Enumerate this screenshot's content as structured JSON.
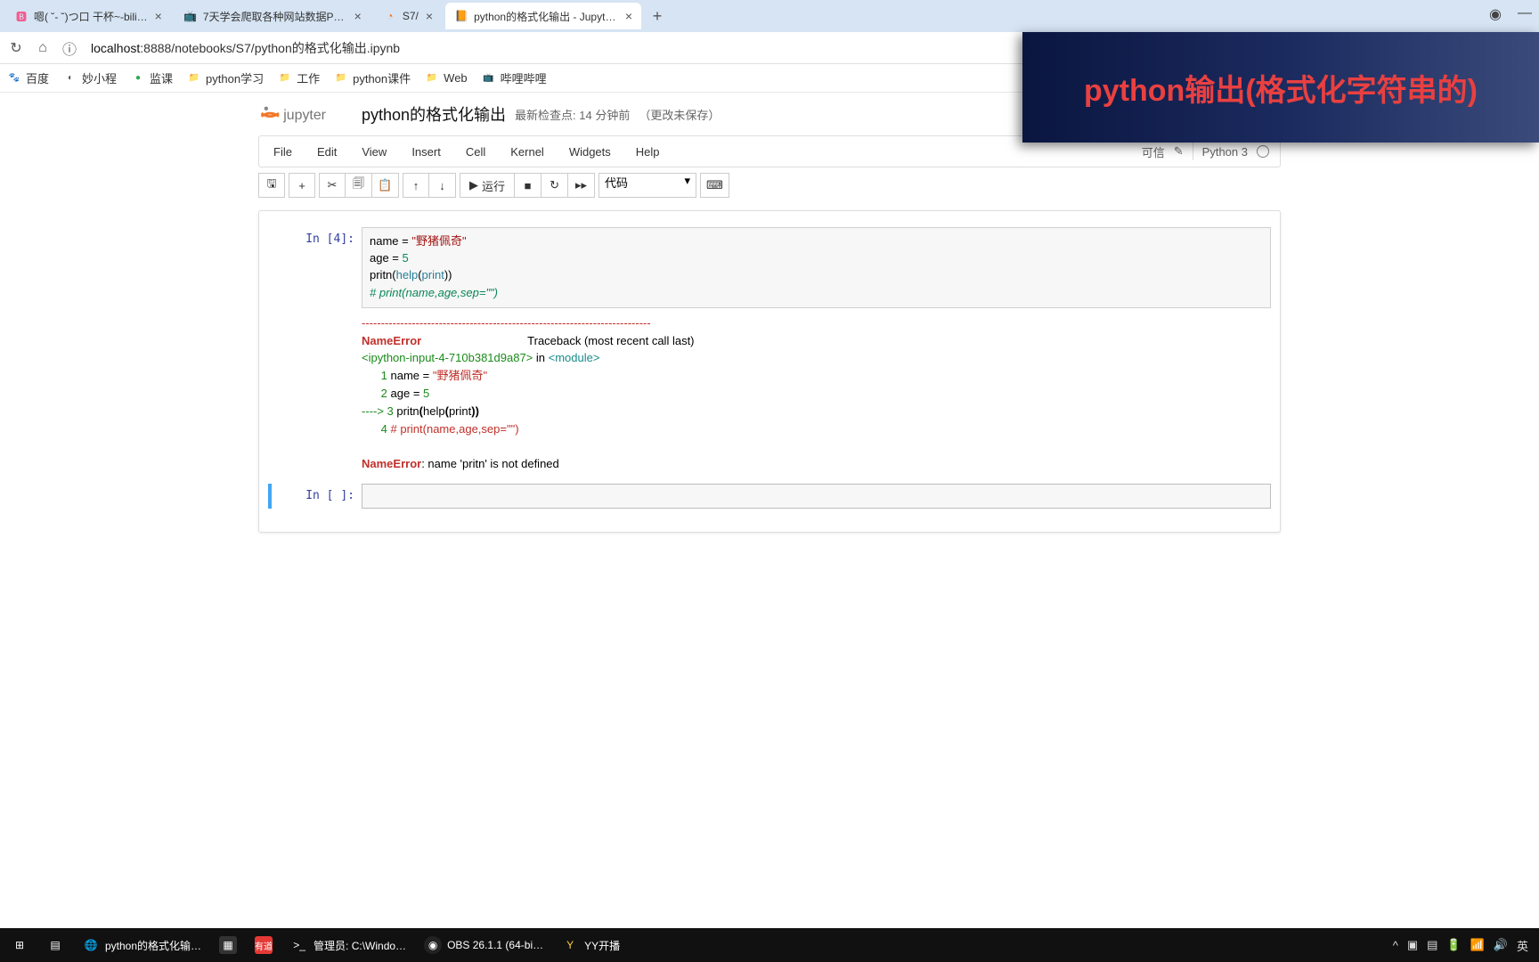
{
  "browser": {
    "tabs": [
      {
        "label": "嗯( ˘- ˘)つ口 干杯~-bili…",
        "favicon": "🅱"
      },
      {
        "label": "7天学会爬取各种网站数据Pytho…",
        "favicon": "📺"
      },
      {
        "label": "S7/",
        "favicon": "📙"
      },
      {
        "label": "python的格式化输出 - Jupyter N…",
        "favicon": "📙",
        "active": true
      }
    ],
    "url_prefix": "localhost",
    "url_rest": ":8888/notebooks/S7/python的格式化输出.ipynb",
    "bookmarks": [
      {
        "label": "百度",
        "icon": "🐾",
        "color": "#3b77db"
      },
      {
        "label": "妙小程",
        "icon": "◐",
        "color": "#555"
      },
      {
        "label": "监课",
        "icon": "●",
        "color": "#2fa84f"
      },
      {
        "label": "python学习",
        "icon": "📁",
        "color": "#f0c24d"
      },
      {
        "label": "工作",
        "icon": "📁",
        "color": "#f0c24d"
      },
      {
        "label": "python课件",
        "icon": "📁",
        "color": "#f0c24d"
      },
      {
        "label": "Web",
        "icon": "📁",
        "color": "#f0c24d"
      },
      {
        "label": "哔哩哔哩",
        "icon": "📺",
        "color": "#00a1d6"
      }
    ]
  },
  "overlay": {
    "text": "python输出(格式化字符串的)"
  },
  "jupyter": {
    "title": "python的格式化输出",
    "checkpoint": "最新检查点: 14 分钟前",
    "autosave": "（更改未保存）",
    "menus": [
      "File",
      "Edit",
      "View",
      "Insert",
      "Cell",
      "Kernel",
      "Widgets",
      "Help"
    ],
    "trusted": "可信",
    "kernel": "Python 3",
    "toolbar": {
      "run": "运行",
      "cell_type": "代码"
    },
    "cell1_prompt": "In  [4]:",
    "code": {
      "l1a": "name = ",
      "l1b": "\"野猪佩奇\"",
      "l2a": "age = ",
      "l2b": "5",
      "l3a": "pritn(",
      "l3b": "help",
      "l3c": "(",
      "l3d": "print",
      "l3e": "))",
      "l4": "# print(name,age,sep=\"\")"
    },
    "out": {
      "dashes": "---------------------------------------------------------------------------",
      "err1a": "NameError",
      "err1b": "                                 Traceback (most recent call last)",
      "err2a": "<ipython-input-4-710b381d9a87>",
      "err2b": " in ",
      "err2c": "<module>",
      "l1n": "      1 ",
      "l1": "name = ",
      "l1s": "\"野猪佩奇\"",
      "l2n": "      2 ",
      "l2": "age = ",
      "l2v": "5",
      "l3arrow": "----> 3 ",
      "l3a": "pritn",
      "l3p1": "(",
      "l3b": "help",
      "l3p2": "(",
      "l3c": "print",
      "l3p3": "))",
      "l4n": "      4 ",
      "l4": "# print(name,age,sep=\"\")",
      "fin_a": "NameError",
      "fin_b": ": name 'pritn' is not defined"
    },
    "cell2_prompt": "In  [ ]:"
  },
  "taskbar": {
    "items": [
      {
        "label": "python的格式化输…",
        "color": "#fff"
      },
      {
        "label": "",
        "color": ""
      },
      {
        "label": "",
        "color": ""
      },
      {
        "label": "管理员: C:\\Windo…",
        "color": "#fff"
      },
      {
        "label": "OBS 26.1.1 (64-bi…",
        "color": "#fff"
      },
      {
        "label": "YY开播",
        "color": "#fff"
      }
    ],
    "lang": "英"
  }
}
